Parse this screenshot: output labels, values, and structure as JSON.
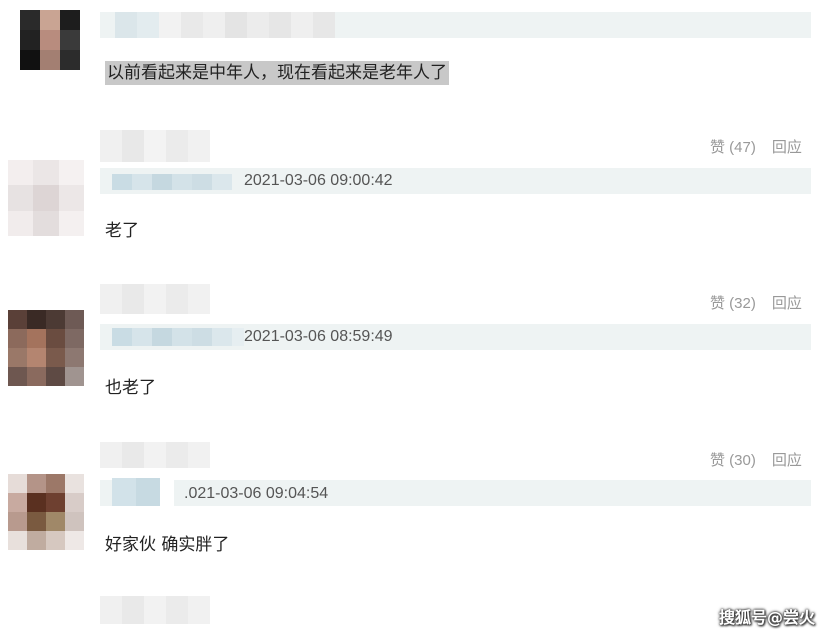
{
  "comments": [
    {
      "text": "以前看起来是中年人，现在看起来是老年人了"
    },
    {
      "likes_label": "赞 (47)",
      "reply_label": "回应",
      "timestamp": "2021-03-06 09:00:42",
      "text": "老了"
    },
    {
      "likes_label": "赞 (32)",
      "reply_label": "回应",
      "timestamp": "2021-03-06 08:59:49",
      "text": "也老了"
    },
    {
      "likes_label": "赞 (30)",
      "reply_label": "回应",
      "timestamp": ".021-03-06 09:04:54",
      "text": "好家伙 确实胖了"
    }
  ],
  "watermark": "搜狐号@尝火",
  "colors": {
    "meta_bar": "#eef3f3",
    "highlight": "#c8c8c8",
    "action_text": "#999999"
  }
}
